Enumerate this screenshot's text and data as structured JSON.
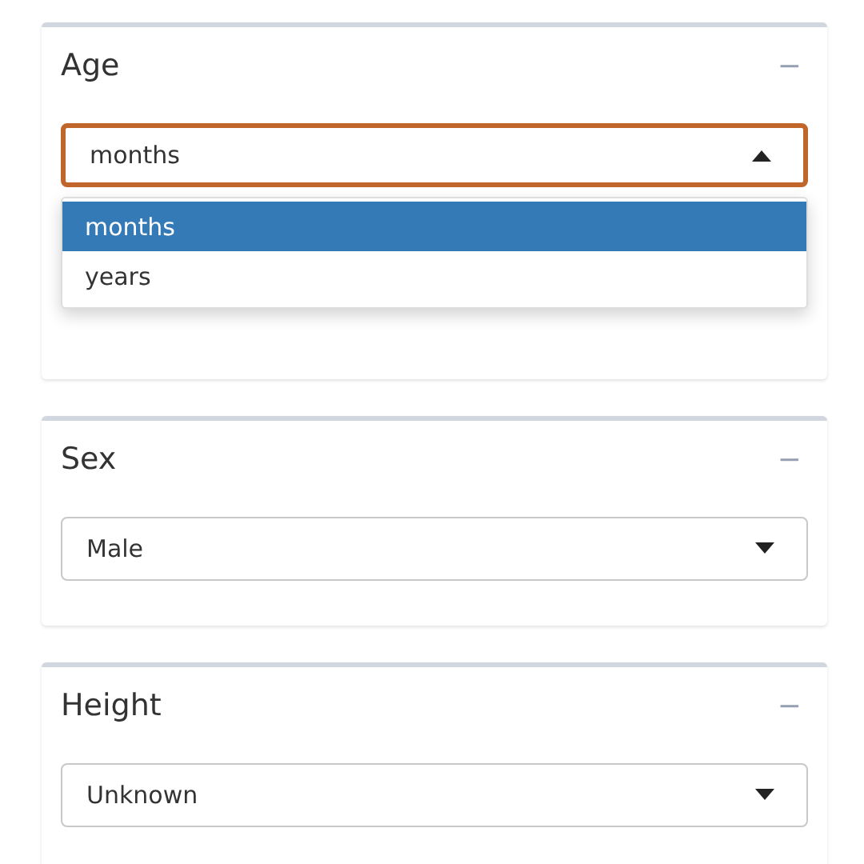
{
  "cards": [
    {
      "title": "Age",
      "collapse_symbol": "−",
      "select": {
        "value": "months",
        "open": true,
        "options": [
          {
            "label": "months",
            "selected": true
          },
          {
            "label": "years",
            "selected": false
          }
        ]
      }
    },
    {
      "title": "Sex",
      "collapse_symbol": "−",
      "select": {
        "value": "Male",
        "open": false
      }
    },
    {
      "title": "Height",
      "collapse_symbol": "−",
      "select": {
        "value": "Unknown",
        "open": false
      }
    }
  ]
}
